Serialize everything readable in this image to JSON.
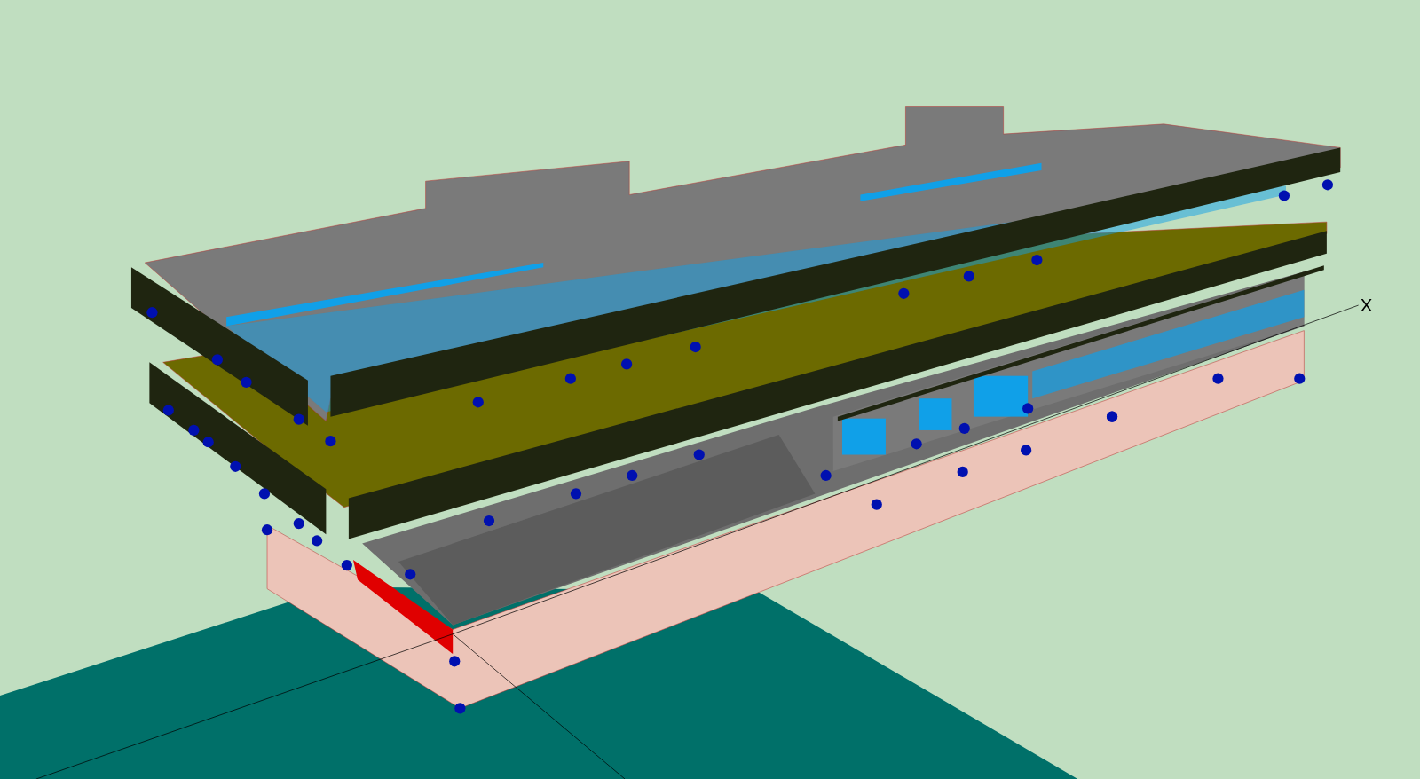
{
  "viewport": {
    "axis_label": "X"
  }
}
